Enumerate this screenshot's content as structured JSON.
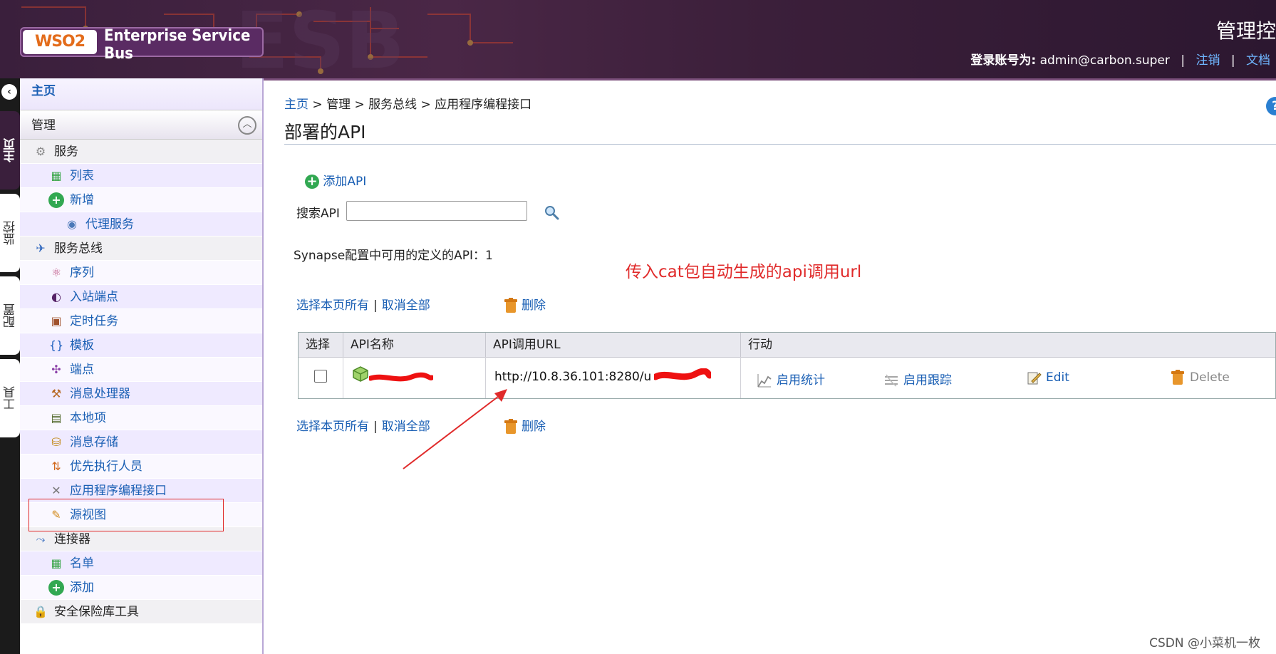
{
  "header": {
    "logo_mark": "WSO2",
    "product_name": "Enterprise Service Bus",
    "console_title": "管理控",
    "login_label": "登录账号为:",
    "login_user": "admin@carbon.super",
    "logout_link": "注销",
    "docs_link": "文档"
  },
  "left_tabs": {
    "home": "主页",
    "monitor": "监控",
    "configure": "配置",
    "tools": "工具"
  },
  "sidebar": {
    "home": "主页",
    "manage": "管理",
    "items": [
      {
        "label": "服务",
        "level": "category",
        "icon": "gear-icon"
      },
      {
        "label": "列表",
        "level": "sub",
        "icon": "list-icon"
      },
      {
        "label": "新增",
        "level": "sub",
        "icon": "add-icon"
      },
      {
        "label": "代理服务",
        "level": "subsub",
        "icon": "proxy-service-icon"
      },
      {
        "label": "服务总线",
        "level": "category",
        "icon": "service-bus-icon"
      },
      {
        "label": "序列",
        "level": "sub",
        "icon": "sequence-icon"
      },
      {
        "label": "入站端点",
        "level": "sub",
        "icon": "inbound-endpoint-icon"
      },
      {
        "label": "定时任务",
        "level": "sub",
        "icon": "scheduled-task-icon"
      },
      {
        "label": "模板",
        "level": "sub",
        "icon": "template-icon"
      },
      {
        "label": "端点",
        "level": "sub",
        "icon": "endpoint-icon"
      },
      {
        "label": "消息处理器",
        "level": "sub",
        "icon": "message-processor-icon"
      },
      {
        "label": "本地项",
        "level": "sub",
        "icon": "local-entry-icon"
      },
      {
        "label": "消息存储",
        "level": "sub",
        "icon": "message-store-icon"
      },
      {
        "label": "优先执行人员",
        "level": "sub",
        "icon": "priority-executor-icon"
      },
      {
        "label": "应用程序编程接口",
        "level": "sub",
        "icon": "api-icon"
      },
      {
        "label": "源视图",
        "level": "sub",
        "icon": "source-view-icon"
      },
      {
        "label": "连接器",
        "level": "category",
        "icon": "connector-icon"
      },
      {
        "label": "名单",
        "level": "sub",
        "icon": "list-icon"
      },
      {
        "label": "添加",
        "level": "sub",
        "icon": "add-icon"
      },
      {
        "label": "安全保险库工具",
        "level": "category",
        "icon": "lock-icon"
      }
    ]
  },
  "breadcrumb": {
    "home": "主页",
    "sep": " > ",
    "manage": "管理",
    "service_bus": "服务总线",
    "current": "应用程序编程接口"
  },
  "main": {
    "title": "部署的API",
    "add_api": "添加API",
    "search_label": "搜索API",
    "search_value": "",
    "count_text": "Synapse配置中可用的定义的API：1",
    "annotation": "传入cat包自动生成的api调用url",
    "select_all": "选择本页所有",
    "deselect_all": "取消全部",
    "delete": "删除"
  },
  "table": {
    "headers": [
      "选择",
      "API名称",
      "API调用URL",
      "行动"
    ],
    "rows": [
      {
        "url": "http://10.8.36.101:8280/u",
        "actions": [
          "启用统计",
          "启用跟踪",
          "Edit",
          "Delete"
        ]
      }
    ]
  },
  "watermark": "CSDN @小菜机一枚",
  "colors": {
    "header_bg": "#3a1f3c",
    "link": "#1a5fb4",
    "annotation": "#e02a2a"
  }
}
